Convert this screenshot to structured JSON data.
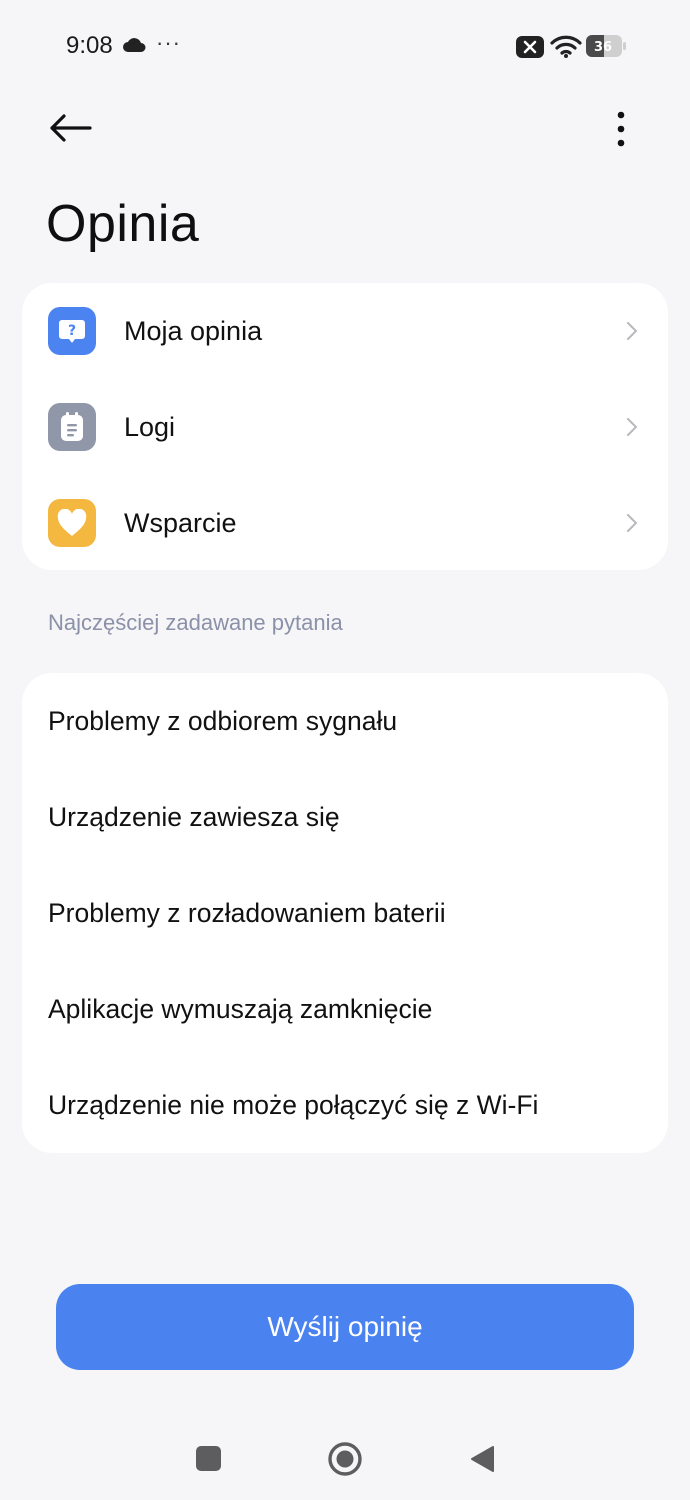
{
  "status_bar": {
    "time": "9:08",
    "more": "···",
    "battery_level": "36",
    "icons": [
      "cloud-icon",
      "notification-off-icon",
      "wifi-icon",
      "battery-icon"
    ]
  },
  "app_bar": {
    "back_icon": "arrow-left-icon",
    "more_icon": "more-vertical-icon"
  },
  "page": {
    "title": "Opinia"
  },
  "menu": {
    "items": [
      {
        "label": "Moja opinia",
        "icon": "question-bubble-icon",
        "color": "#4b83f1"
      },
      {
        "label": "Logi",
        "icon": "clipboard-icon",
        "color": "#8f97a8"
      },
      {
        "label": "Wsparcie",
        "icon": "heart-icon",
        "color": "#f4b840"
      }
    ]
  },
  "faq": {
    "header": "Najczęściej zadawane pytania",
    "items": [
      {
        "label": "Problemy z odbiorem sygnału"
      },
      {
        "label": "Urządzenie zawiesza się"
      },
      {
        "label": "Problemy z rozładowaniem baterii"
      },
      {
        "label": "Aplikacje wymuszają zamknięcie"
      },
      {
        "label": "Urządzenie nie może połączyć się z Wi-Fi"
      }
    ]
  },
  "send_button": {
    "label": "Wyślij opinię",
    "color": "#4a82f0"
  },
  "nav_bar": {
    "icons": [
      "recents-square-icon",
      "home-circle-icon",
      "back-triangle-icon"
    ]
  }
}
